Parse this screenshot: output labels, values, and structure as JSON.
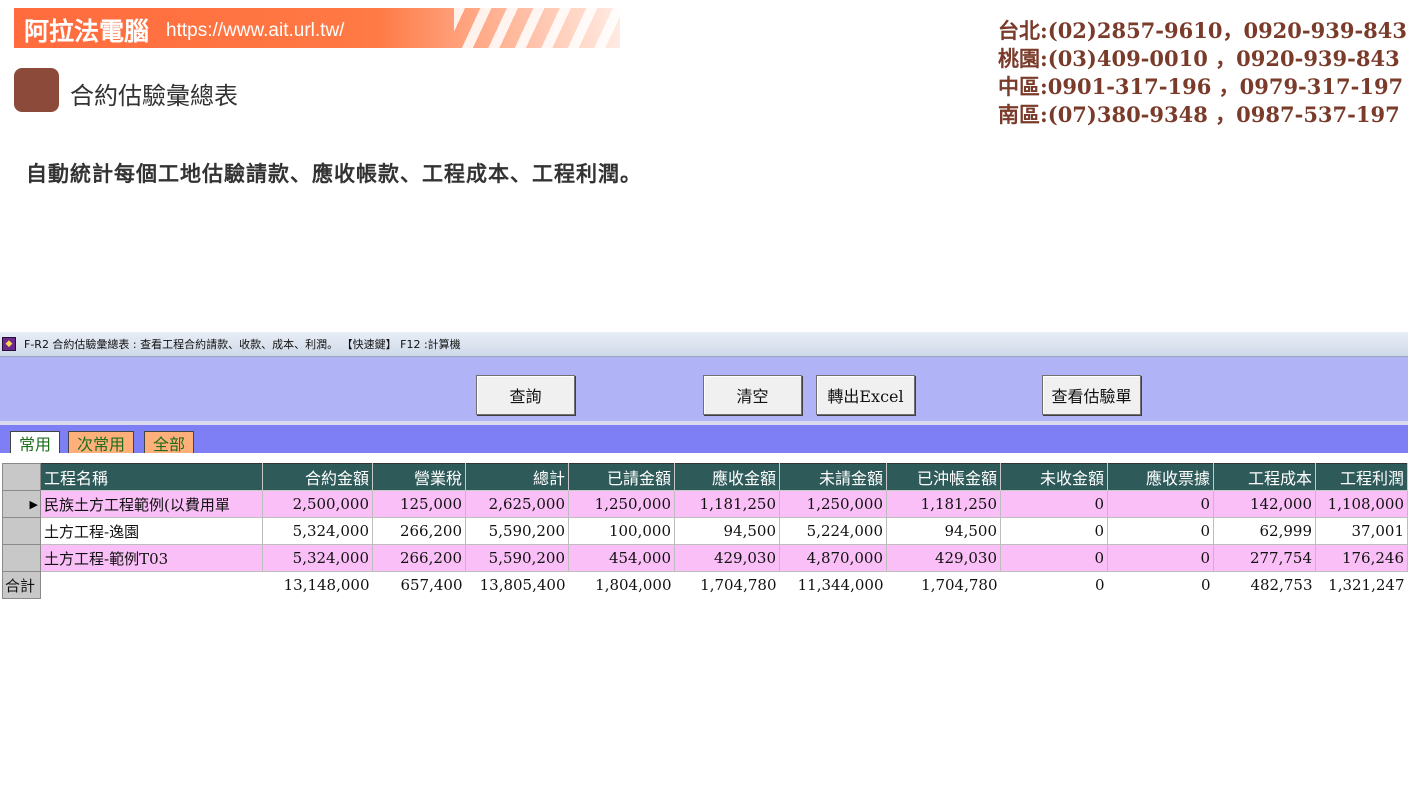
{
  "brand": {
    "name": "阿拉法電腦",
    "url": "https://www.ait.url.tw/"
  },
  "page_title": "合約估驗彙總表",
  "contacts": [
    "台北:(02)2857-9610，0920-939-843",
    "桃園:(03)409-0010  ，0920-939-843",
    "中區:0901-317-196  ，0979-317-197",
    "南區:(07)380-9348  ，0987-537-197"
  ],
  "tagline": "自動統計每個工地估驗請款、應收帳款、工程成本、工程利潤。",
  "window": {
    "title": "F-R2 合約估驗彙總表 : 查看工程合約請款、收款、成本、利潤。 【快速鍵】 F12 :計算機"
  },
  "toolbar": {
    "query_label": "查詢",
    "clear_label": "清空",
    "excel_label": "轉出Excel",
    "view_label": "查看估驗單"
  },
  "tabs": [
    "常用",
    "次常用",
    "全部"
  ],
  "grid": {
    "columns": [
      "工程名稱",
      "合約金額",
      "營業稅",
      "總計",
      "已請金額",
      "應收金額",
      "未請金額",
      "已沖帳金額",
      "未收金額",
      "應收票據",
      "工程成本",
      "工程利潤"
    ],
    "rows": [
      [
        "民族土方工程範例(以費用單",
        "2,500,000",
        "125,000",
        "2,625,000",
        "1,250,000",
        "1,181,250",
        "1,250,000",
        "1,181,250",
        "0",
        "0",
        "142,000",
        "1,108,000"
      ],
      [
        "土方工程-逸園",
        "5,324,000",
        "266,200",
        "5,590,200",
        "100,000",
        "94,500",
        "5,224,000",
        "94,500",
        "0",
        "0",
        "62,999",
        "37,001"
      ],
      [
        "土方工程-範例T03",
        "5,324,000",
        "266,200",
        "5,590,200",
        "454,000",
        "429,030",
        "4,870,000",
        "429,030",
        "0",
        "0",
        "277,754",
        "176,246"
      ]
    ],
    "total_label": "合計",
    "totals": [
      "13,148,000",
      "657,400",
      "13,805,400",
      "1,804,000",
      "1,704,780",
      "11,344,000",
      "1,704,780",
      "0",
      "0",
      "482,753",
      "1,321,247"
    ]
  },
  "colors": {
    "brand_orange": "#ff6b3d",
    "toolbar_bg": "#b0b3f5",
    "tabstrip_bg": "#7f7ff5",
    "header_bg": "#2f5a5a",
    "row_pink": "#f9bff6"
  }
}
